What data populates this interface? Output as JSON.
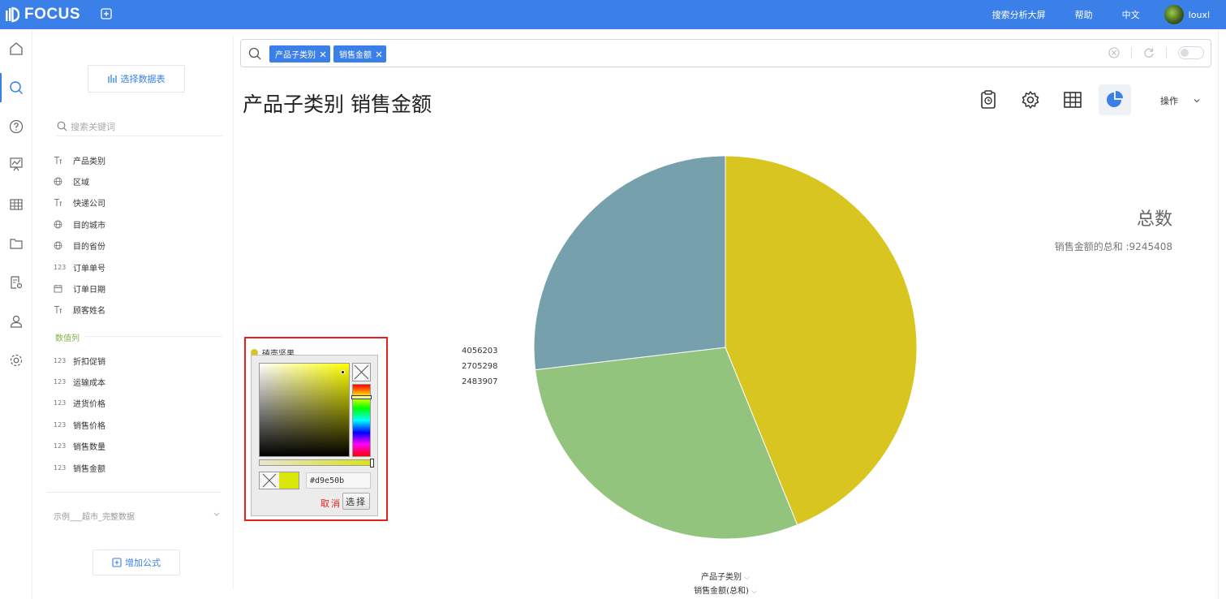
{
  "app": {
    "logo_text": "FOCUS",
    "top_links": [
      "搜索分析大屏",
      "帮助",
      "中文"
    ],
    "username": "louxl"
  },
  "panel": {
    "choose_table_label": "选择数据表",
    "search_placeholder": "搜索关键词",
    "dimension_fields": [
      {
        "icon": "text-field-icon",
        "label": "产品类别"
      },
      {
        "icon": "globe-icon",
        "label": "区域"
      },
      {
        "icon": "text-field-icon",
        "label": "快递公司"
      },
      {
        "icon": "globe-icon",
        "label": "目的城市"
      },
      {
        "icon": "globe-icon",
        "label": "目的省份"
      },
      {
        "icon": "number-icon",
        "label": "订单单号"
      },
      {
        "icon": "calendar-icon",
        "label": "订单日期"
      },
      {
        "icon": "text-field-icon",
        "label": "顾客姓名"
      }
    ],
    "measures_title": "数值列",
    "measure_fields": [
      {
        "icon": "number-icon",
        "label": "折扣促销"
      },
      {
        "icon": "number-icon",
        "label": "运输成本"
      },
      {
        "icon": "number-icon",
        "label": "进货价格"
      },
      {
        "icon": "number-icon",
        "label": "销售价格"
      },
      {
        "icon": "number-icon",
        "label": "销售数量"
      },
      {
        "icon": "number-icon",
        "label": "销售金额"
      }
    ],
    "number_icon_text": "123",
    "source_label": "示例___超市_完整数据",
    "add_formula_label": "增加公式"
  },
  "search": {
    "tokens": [
      "产品子类别",
      "销售金额"
    ]
  },
  "page": {
    "title": "产品子类别 销售金额",
    "ops_label": "操作"
  },
  "chart_data": {
    "type": "pie",
    "slices": [
      {
        "value": 4056203,
        "color": "#d9c51f"
      },
      {
        "value": 2705298,
        "color": "#93c47d"
      },
      {
        "value": 2483907,
        "color": "#76a1ac"
      }
    ],
    "value_labels": [
      "4056203",
      "2705298",
      "2483907"
    ],
    "total_title": "总数",
    "total_text": "销售金额的总和 :9245408",
    "x_field": "产品子类别",
    "y_field": "销售金额(总和)"
  },
  "color_picker": {
    "legend_name": "磕壳坚果",
    "hex_value": "#d9e50b",
    "cancel_label": "取消",
    "choose_label": "选择"
  }
}
